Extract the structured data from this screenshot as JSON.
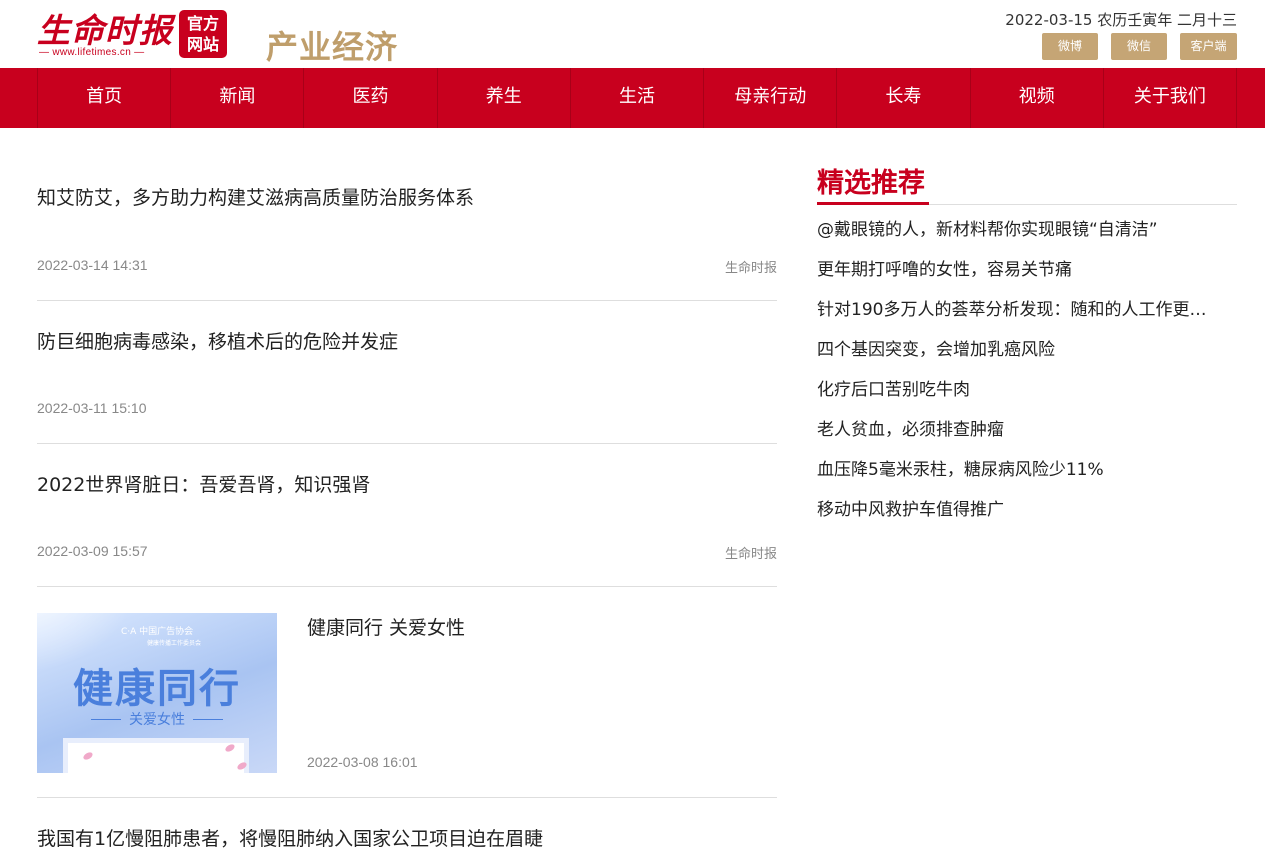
{
  "header": {
    "logo_text": "生命时报",
    "logo_url": "— www.lifetimes.cn —",
    "official_line1": "官方",
    "official_line2": "网站",
    "section_title": "产业经济",
    "date": "2022-03-15 农历壬寅年 二月十三",
    "social": {
      "weibo": "微博",
      "weixin": "微信",
      "client": "客户端"
    }
  },
  "nav": {
    "items": [
      "首页",
      "新闻",
      "医药",
      "养生",
      "生活",
      "母亲行动",
      "长寿",
      "视频",
      "关于我们"
    ]
  },
  "articles": [
    {
      "title": "知艾防艾，多方助力构建艾滋病高质量防治服务体系",
      "time": "2022-03-14 14:31",
      "source": "生命时报"
    },
    {
      "title": "防巨细胞病毒感染，移植术后的危险并发症",
      "time": "2022-03-11 15:10",
      "source": ""
    },
    {
      "title": "2022世界肾脏日：吾爱吾肾，知识强肾",
      "time": "2022-03-09 15:57",
      "source": "生命时报"
    },
    {
      "title": "健康同行 关爱女性",
      "time": "2022-03-08 16:01",
      "image": {
        "org": "C·A 中国广告协会",
        "org_sub": "健康传播工作委员会",
        "title": "健康同行",
        "subtitle": "关爱女性"
      }
    },
    {
      "title": "我国有1亿慢阻肺患者，将慢阻肺纳入国家公卫项目迫在眉睫"
    }
  ],
  "sidebar": {
    "heading": "精选推荐",
    "items": [
      "@戴眼镜的人，新材料帮你实现眼镜“自清洁”",
      "更年期打呼噜的女性，容易关节痛",
      "针对190多万人的荟萃分析发现：随和的人工作更…",
      "四个基因突变，会增加乳癌风险",
      "化疗后口苦别吃牛肉",
      "老人贫血，必须排查肿瘤",
      "血压降5毫米汞柱，糖尿病风险少11%",
      "移动中风救护车值得推广"
    ]
  },
  "colors": {
    "brand_red": "#c8001e",
    "gold": "#c5a575",
    "section_gold": "#bf9e6b"
  }
}
